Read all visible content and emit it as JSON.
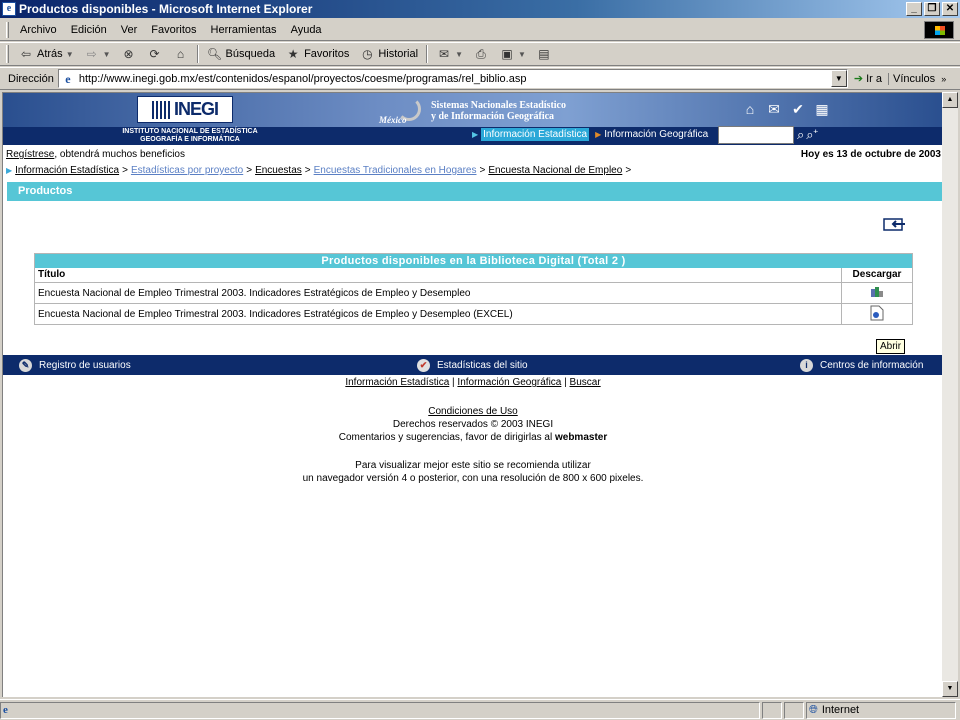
{
  "window": {
    "title": "Productos disponibles - Microsoft Internet Explorer",
    "buttons": [
      "_",
      "❐",
      "✕"
    ]
  },
  "menu": [
    "Archivo",
    "Edición",
    "Ver",
    "Favoritos",
    "Herramientas",
    "Ayuda"
  ],
  "toolbar": {
    "back": "Atrás",
    "search": "Búsqueda",
    "favorites": "Favoritos",
    "history": "Historial"
  },
  "address": {
    "label": "Dirección",
    "url": "http://www.inegi.gob.mx/est/contenidos/espanol/proyectos/coesme/programas/rel_biblio.asp",
    "go": "Ir a",
    "links": "Vínculos"
  },
  "header": {
    "logo": "INEGI",
    "full_name_1": "INSTITUTO NACIONAL DE ESTADÍSTICA",
    "full_name_2": "GEOGRAFÍA E INFORMÁTICA",
    "sne_line1": "Sistemas Nacionales Estadístico",
    "sne_line2": "y de Información Geográfica",
    "mexico": "México",
    "tab_active": "Información Estadística",
    "tab_other": "Información Geográfica"
  },
  "info": {
    "register_link": "Regístrese",
    "register_text": ", obtendrá muchos beneficios",
    "date": "Hoy es 13 de octubre de 2003"
  },
  "breadcrumb": [
    "Información Estadística",
    "Estadísticas por proyecto",
    "Encuestas",
    "Encuestas Tradicionales en Hogares",
    "Encuesta Nacional de Empleo"
  ],
  "section_title": "Productos",
  "table": {
    "title": "Productos disponibles en la Biblioteca Digital (Total 2 )",
    "col_title": "Título",
    "col_download": "Descargar",
    "rows": [
      "Encuesta Nacional de Empleo Trimestral 2003. Indicadores Estratégicos de Empleo y Desempleo",
      "Encuesta Nacional de Empleo Trimestral 2003. Indicadores Estratégicos de Empleo y Desempleo (EXCEL)"
    ]
  },
  "tooltip": "Abrir",
  "footer_bar": {
    "registro": "Registro de usuarios",
    "estadisticas": "Estadísticas del sitio",
    "centros": "Centros de información"
  },
  "footer_links": [
    "Información Estadística",
    "Información Geográfica",
    "Buscar"
  ],
  "footer": {
    "conditions": "Condiciones de Uso",
    "rights": "Derechos reservados © 2003 INEGI",
    "comments": "Comentarios y sugerencias, favor de dirigirlas al",
    "webmaster": "webmaster",
    "recommend1": "Para visualizar mejor este sitio se recomienda utilizar",
    "recommend2": "un navegador versión 4 o posterior, con una resolución de 800 x 600 pixeles."
  },
  "status": {
    "zone": "Internet"
  }
}
